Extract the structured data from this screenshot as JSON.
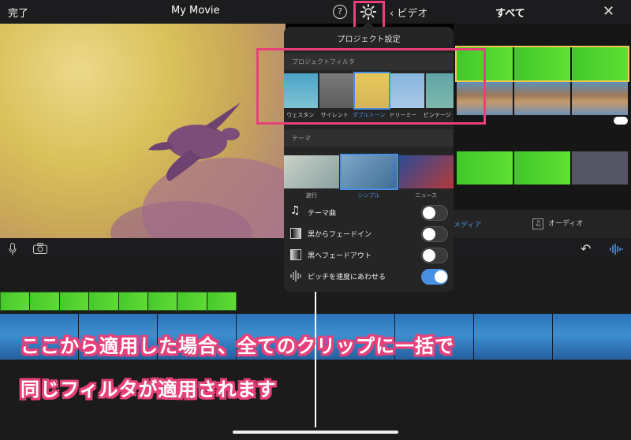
{
  "topbar": {
    "done_label": "完了",
    "title": "My Movie",
    "help_glyph": "?",
    "back_label": "ビデオ",
    "all_label": "すべて",
    "close_glyph": "✕"
  },
  "popover": {
    "title": "プロジェクト設定",
    "filter_section": "プロジェクトフィルタ",
    "filters": [
      {
        "label": "ウェスタン",
        "selected": false
      },
      {
        "label": "サイレント",
        "selected": false
      },
      {
        "label": "ダブルトーン",
        "selected": true
      },
      {
        "label": "ドリーミー",
        "selected": false
      },
      {
        "label": "ビンテージ",
        "selected": false
      }
    ],
    "theme_section": "テーマ",
    "themes": [
      {
        "label": "旅行",
        "selected": false
      },
      {
        "label": "シンプル",
        "selected": true
      },
      {
        "label": "ニュース",
        "selected": false
      }
    ],
    "settings": [
      {
        "label": "テーマ曲",
        "icon": "music-note-icon",
        "on": false
      },
      {
        "label": "黒からフェードイン",
        "icon": "fade-in-icon",
        "on": false
      },
      {
        "label": "黒へフェードアウト",
        "icon": "fade-out-icon",
        "on": false
      },
      {
        "label": "ピッチを速度にあわせる",
        "icon": "waveform-icon",
        "on": true
      }
    ]
  },
  "media": {
    "tab_media": "メディア",
    "tab_audio": "オーディオ"
  },
  "caption": {
    "line1": "ここから適用した場合、全てのクリップに一括で",
    "line2": "同じフィルタが適用されます"
  },
  "colors": {
    "accent": "#4a90e2",
    "highlight": "#e8407a",
    "toggle_on": "#4a90e2"
  }
}
